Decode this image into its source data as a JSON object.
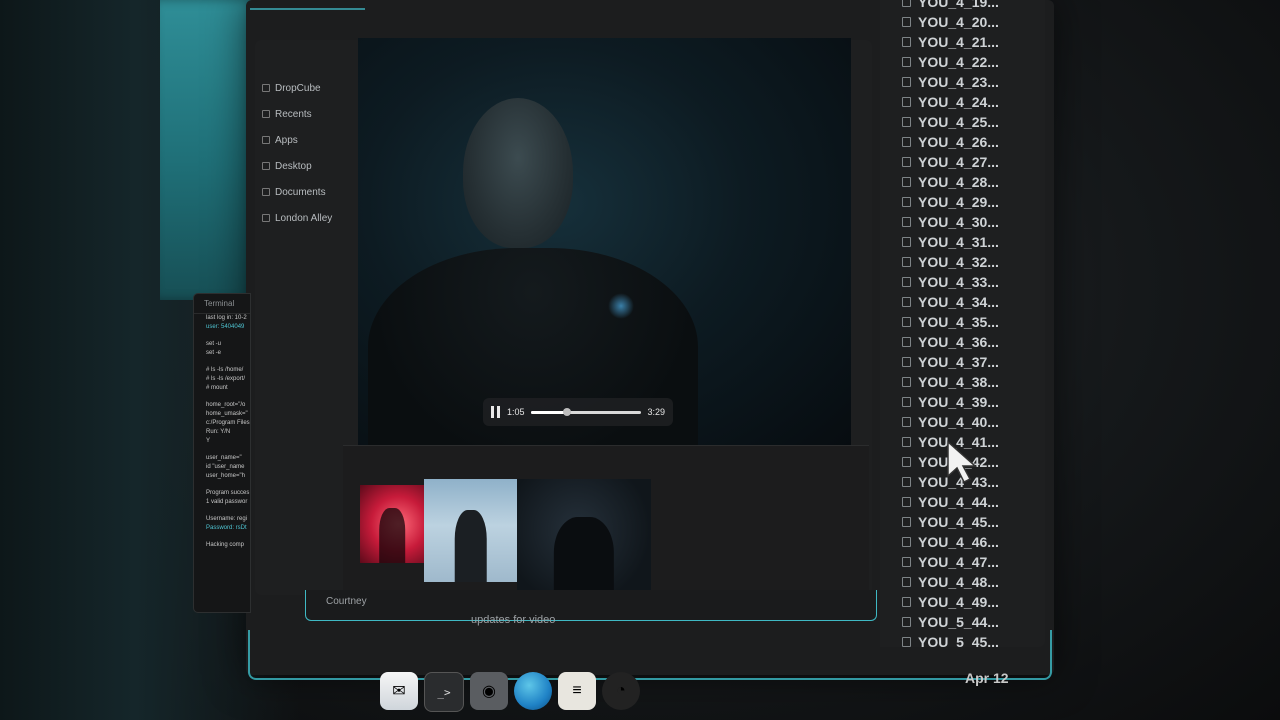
{
  "sidebar": {
    "items": [
      {
        "label": "DropCube"
      },
      {
        "label": "Recents"
      },
      {
        "label": "Apps"
      },
      {
        "label": "Desktop"
      },
      {
        "label": "Documents"
      },
      {
        "label": "London Alley"
      }
    ]
  },
  "player": {
    "current_time": "1:05",
    "duration": "3:29",
    "progress": 0.33
  },
  "terminal": {
    "title": "Terminal",
    "lines": [
      {
        "text": "last log in: 10-2",
        "cyan": false
      },
      {
        "text": "user: 5404049",
        "cyan": true
      },
      {
        "text": "",
        "cyan": false
      },
      {
        "text": "set -u",
        "cyan": false
      },
      {
        "text": "set -e",
        "cyan": false
      },
      {
        "text": "",
        "cyan": false
      },
      {
        "text": "# ls -ls /home/",
        "cyan": false
      },
      {
        "text": "# ls -ls /export/",
        "cyan": false
      },
      {
        "text": "# mount",
        "cyan": false
      },
      {
        "text": "",
        "cyan": false
      },
      {
        "text": "home_root=\"/o",
        "cyan": false
      },
      {
        "text": "home_umask=\"",
        "cyan": false
      },
      {
        "text": "c:/Program Files",
        "cyan": false
      },
      {
        "text": "Run: Y/N",
        "cyan": false
      },
      {
        "text": "Y",
        "cyan": false
      },
      {
        "text": "",
        "cyan": false
      },
      {
        "text": "user_name=\"",
        "cyan": false
      },
      {
        "text": "id \"user_name",
        "cyan": false
      },
      {
        "text": "user_home=\"h",
        "cyan": false
      },
      {
        "text": "",
        "cyan": false
      },
      {
        "text": "Program succes",
        "cyan": false
      },
      {
        "text": "1 valid passwor",
        "cyan": false
      },
      {
        "text": "",
        "cyan": false
      },
      {
        "text": "Username: regi",
        "cyan": false
      },
      {
        "text": "Password: rsDt",
        "cyan": true
      },
      {
        "text": "",
        "cyan": false
      },
      {
        "text": "Hacking comp",
        "cyan": false
      }
    ]
  },
  "notification": {
    "name": "Courtney",
    "message": "updates for video"
  },
  "files": [
    "YOU_4_19...",
    "YOU_4_20...",
    "YOU_4_21...",
    "YOU_4_22...",
    "YOU_4_23...",
    "YOU_4_24...",
    "YOU_4_25...",
    "YOU_4_26...",
    "YOU_4_27...",
    "YOU_4_28...",
    "YOU_4_29...",
    "YOU_4_30...",
    "YOU_4_31...",
    "YOU_4_32...",
    "YOU_4_33...",
    "YOU_4_34...",
    "YOU_4_35...",
    "YOU_4_36...",
    "YOU_4_37...",
    "YOU_4_38...",
    "YOU_4_39...",
    "YOU_4_40...",
    "YOU_4_41...",
    "YOU_4_42...",
    "YOU_4_43...",
    "YOU_4_44...",
    "YOU_4_45...",
    "YOU_4_46...",
    "YOU_4_47...",
    "YOU_4_48...",
    "YOU_4_49...",
    "YOU_5_44...",
    "YOU_5_45..."
  ],
  "date": "Apr 12",
  "dock": {
    "apps": [
      {
        "name": "mail-icon",
        "glyph": "✉"
      },
      {
        "name": "terminal-icon",
        "glyph": "_>"
      },
      {
        "name": "camera-icon",
        "glyph": "◉"
      },
      {
        "name": "globe-icon",
        "glyph": ""
      },
      {
        "name": "notes-icon",
        "glyph": "≡"
      },
      {
        "name": "clock-icon",
        "glyph": "◔"
      }
    ]
  },
  "colors": {
    "accent_teal": "#3fc7d3",
    "panel_bg": "#1e1f20"
  }
}
